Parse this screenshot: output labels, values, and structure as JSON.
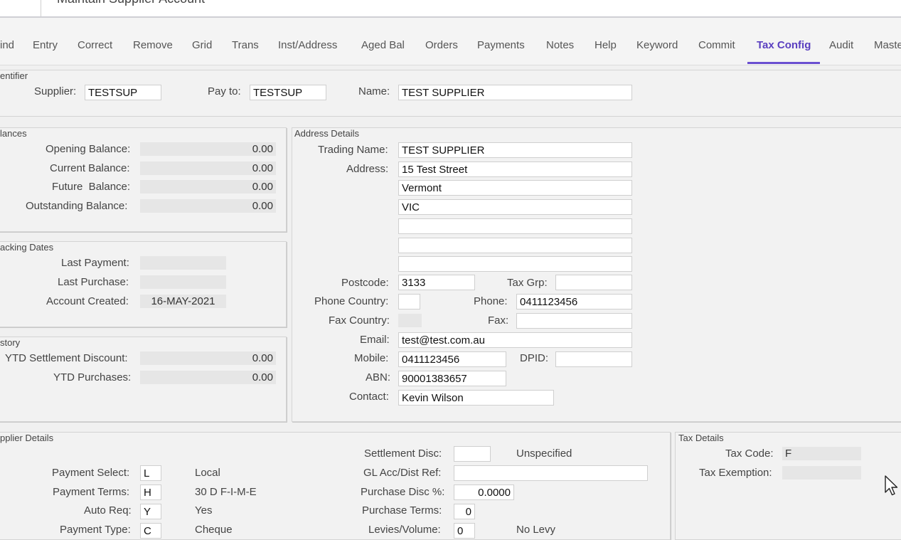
{
  "window": {
    "title": "Maintain Supplier Account"
  },
  "tabs": [
    {
      "label": "ind"
    },
    {
      "label": "Entry"
    },
    {
      "label": "Correct"
    },
    {
      "label": "Remove"
    },
    {
      "label": "Grid"
    },
    {
      "label": "Trans"
    },
    {
      "label": "Inst/Address"
    },
    {
      "label": "Aged Bal"
    },
    {
      "label": "Orders"
    },
    {
      "label": "Payments"
    },
    {
      "label": "Notes"
    },
    {
      "label": "Help"
    },
    {
      "label": "Keyword"
    },
    {
      "label": "Commit"
    },
    {
      "label": "Tax Config"
    },
    {
      "label": "Audit"
    },
    {
      "label": "Maste"
    }
  ],
  "identifier": {
    "legend": "entifier",
    "supplier_label": "Supplier:",
    "supplier_value": "TESTSUP",
    "payto_label": "Pay to:",
    "payto_value": "TESTSUP",
    "name_label": "Name:",
    "name_value": "TEST SUPPLIER"
  },
  "balances": {
    "legend": "lances",
    "opening_label": "Opening Balance:",
    "opening_value": "0.00",
    "current_label": "Current Balance:",
    "current_value": "0.00",
    "future_label": "Future  Balance:",
    "future_value": "0.00",
    "outstanding_label": "Outstanding Balance:",
    "outstanding_value": "0.00"
  },
  "tracking": {
    "legend": "acking Dates",
    "last_payment_label": "Last Payment:",
    "last_payment_value": "",
    "last_purchase_label": "Last Purchase:",
    "last_purchase_value": "",
    "created_label": "Account Created:",
    "created_value": "16-MAY-2021"
  },
  "history": {
    "legend": "story",
    "ytd_disc_label": "YTD Settlement Discount:",
    "ytd_disc_value": "0.00",
    "ytd_purch_label": "YTD Purchases:",
    "ytd_purch_value": "0.00"
  },
  "address": {
    "legend": "Address Details",
    "trading_label": "Trading Name:",
    "trading_value": "TEST SUPPLIER",
    "address_label": "Address:",
    "lines": [
      "15 Test Street",
      "Vermont",
      "VIC",
      "",
      "",
      ""
    ],
    "postcode_label": "Postcode:",
    "postcode_value": "3133",
    "taxgrp_label": "Tax Grp:",
    "taxgrp_value": "",
    "phone_country_label": "Phone Country:",
    "phone_country_value": "",
    "phone_label": "Phone:",
    "phone_value": "0411123456",
    "fax_country_label": "Fax Country:",
    "fax_country_value": "",
    "fax_label": "Fax:",
    "fax_value": "",
    "email_label": "Email:",
    "email_value": "test@test.com.au",
    "mobile_label": "Mobile:",
    "mobile_value": "0411123456",
    "dpid_label": "DPID:",
    "dpid_value": "",
    "abn_label": "ABN:",
    "abn_value": "90001383657",
    "contact_label": "Contact:",
    "contact_value": "Kevin Wilson"
  },
  "supplier_details": {
    "legend": "pplier Details",
    "pay_select_label": "Payment Select:",
    "pay_select_value": "L",
    "pay_select_desc": "Local",
    "pay_terms_label": "Payment Terms:",
    "pay_terms_value": "H",
    "pay_terms_desc": "30 D F-I-M-E",
    "auto_req_label": "Auto Req:",
    "auto_req_value": "Y",
    "auto_req_desc": "Yes",
    "pay_type_label": "Payment Type:",
    "pay_type_value": "C",
    "pay_type_desc": "Cheque",
    "settle_label": "Settlement Disc:",
    "settle_value": "",
    "settle_desc": "Unspecified",
    "gl_label": "GL Acc/Dist Ref:",
    "gl_value": "",
    "purch_disc_label": "Purchase Disc %:",
    "purch_disc_value": "0.0000",
    "purch_terms_label": "Purchase Terms:",
    "purch_terms_value": "0",
    "levies_label": "Levies/Volume:",
    "levies_value": "0",
    "levies_desc": "No Levy"
  },
  "tax": {
    "legend": "Tax Details",
    "code_label": "Tax Code:",
    "code_value": "F",
    "exemption_label": "Tax Exemption:",
    "exemption_value": ""
  },
  "colors": {
    "accent": "#5a3fc0",
    "background": "#f0f0f0",
    "field": "#ffffff",
    "readonly": "#e6e6e6"
  }
}
